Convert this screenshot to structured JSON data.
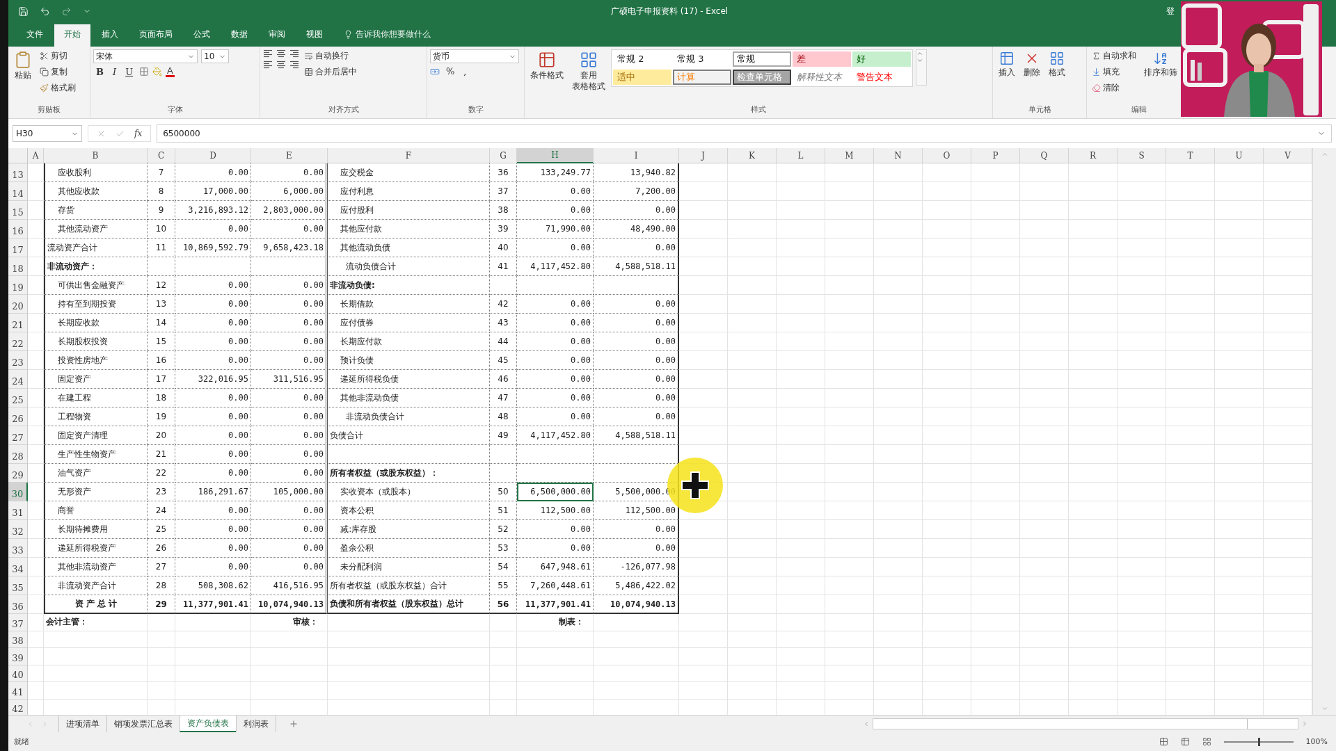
{
  "title_bar": {
    "title": "广硕电子申报资料 (17)  -  Excel",
    "account": "登"
  },
  "menu_tabs": [
    {
      "label": "文件",
      "selected": false
    },
    {
      "label": "开始",
      "selected": true
    },
    {
      "label": "插入",
      "selected": false
    },
    {
      "label": "页面布局",
      "selected": false
    },
    {
      "label": "公式",
      "selected": false
    },
    {
      "label": "数据",
      "selected": false
    },
    {
      "label": "审阅",
      "selected": false
    },
    {
      "label": "视图",
      "selected": false
    }
  ],
  "tell_me": "告诉我你想要做什么",
  "ribbon": {
    "clipboard": {
      "paste": "粘贴",
      "cut": "剪切",
      "copy": "复制",
      "format_painter": "格式刷",
      "label": "剪贴板"
    },
    "font": {
      "name": "宋体",
      "size": "10",
      "bold": "B",
      "italic": "I",
      "underline": "U",
      "font_color": "A",
      "label": "字体"
    },
    "alignment": {
      "wrap": "自动换行",
      "merge": "合并后居中",
      "label": "对齐方式"
    },
    "number": {
      "format": "货币",
      "percent": "%",
      "comma": ",",
      "label": "数字"
    },
    "styles": {
      "conditional": "条件格式",
      "table_format": [
        "套用",
        "表格格式"
      ],
      "label": "样式",
      "gallery": [
        {
          "text": "常规 2",
          "kind": "plain"
        },
        {
          "text": "常规 3",
          "kind": "plain"
        },
        {
          "text": "常规",
          "kind": "framed"
        },
        {
          "text": "差",
          "kind": "bad"
        },
        {
          "text": "好",
          "kind": "good"
        },
        {
          "text": "适中",
          "kind": "neutral"
        },
        {
          "text": "计算",
          "kind": "calc"
        },
        {
          "text": "检查单元格",
          "kind": "check"
        },
        {
          "text": "解释性文本",
          "kind": "explanatory"
        },
        {
          "text": "警告文本",
          "kind": "warning"
        }
      ]
    },
    "cells": {
      "insert": "插入",
      "delete": "删除",
      "format": "格式",
      "label": "单元格"
    },
    "editing": {
      "autosum": "自动求和",
      "fill": "填充",
      "clear": "清除",
      "sort": "排序和筛",
      "label": "编辑"
    }
  },
  "formula_bar": {
    "name_box": "H30",
    "fx": "fx",
    "formula": "6500000"
  },
  "sheet": {
    "columns": [
      {
        "label": "A",
        "selected": false
      },
      {
        "label": "B",
        "selected": false
      },
      {
        "label": "C",
        "selected": false
      },
      {
        "label": "D",
        "selected": false
      },
      {
        "label": "E",
        "selected": false
      },
      {
        "label": "F",
        "selected": false
      },
      {
        "label": "G",
        "selected": false
      },
      {
        "label": "H",
        "selected": true
      },
      {
        "label": "I",
        "selected": false
      },
      {
        "label": "J",
        "selected": false
      },
      {
        "label": "K",
        "selected": false
      },
      {
        "label": "L",
        "selected": false
      },
      {
        "label": "M",
        "selected": false
      },
      {
        "label": "N",
        "selected": false
      },
      {
        "label": "O",
        "selected": false
      },
      {
        "label": "P",
        "selected": false
      },
      {
        "label": "Q",
        "selected": false
      },
      {
        "label": "R",
        "selected": false
      },
      {
        "label": "S",
        "selected": false
      },
      {
        "label": "T",
        "selected": false
      },
      {
        "label": "U",
        "selected": false
      },
      {
        "label": "V",
        "selected": false
      }
    ],
    "row_headers": [
      {
        "label": "13",
        "selected": false
      },
      {
        "label": "14",
        "selected": false
      },
      {
        "label": "15",
        "selected": false
      },
      {
        "label": "16",
        "selected": false
      },
      {
        "label": "17",
        "selected": false
      },
      {
        "label": "18",
        "selected": false
      },
      {
        "label": "19",
        "selected": false
      },
      {
        "label": "20",
        "selected": false
      },
      {
        "label": "21",
        "selected": false
      },
      {
        "label": "22",
        "selected": false
      },
      {
        "label": "23",
        "selected": false
      },
      {
        "label": "24",
        "selected": false
      },
      {
        "label": "25",
        "selected": false
      },
      {
        "label": "26",
        "selected": false
      },
      {
        "label": "27",
        "selected": false
      },
      {
        "label": "28",
        "selected": false
      },
      {
        "label": "29",
        "selected": false
      },
      {
        "label": "30",
        "selected": true
      },
      {
        "label": "31",
        "selected": false
      },
      {
        "label": "32",
        "selected": false
      },
      {
        "label": "33",
        "selected": false
      },
      {
        "label": "34",
        "selected": false
      },
      {
        "label": "35",
        "selected": false
      },
      {
        "label": "36",
        "selected": false
      },
      {
        "label": "37",
        "selected": false
      },
      {
        "label": "38",
        "selected": false
      },
      {
        "label": "39",
        "selected": false
      },
      {
        "label": "40",
        "selected": false
      },
      {
        "label": "41",
        "selected": false
      },
      {
        "label": "42",
        "selected": false
      }
    ],
    "rows": [
      {
        "kind": "item",
        "cells": {
          "B": {
            "text": "    应收股利",
            "bold": false
          },
          "C": {
            "text": "7",
            "bold": false
          },
          "D": {
            "text": "0.00",
            "bold": false
          },
          "E": {
            "text": "0.00",
            "bold": false
          },
          "F": {
            "text": "    应交税金",
            "bold": false
          },
          "G": {
            "text": "36",
            "bold": false
          },
          "H": {
            "text": "133,249.77",
            "bold": false
          },
          "I": {
            "text": "13,940.82",
            "bold": false
          }
        }
      },
      {
        "kind": "item",
        "cells": {
          "B": {
            "text": "    其他应收款",
            "bold": false
          },
          "C": {
            "text": "8",
            "bold": false
          },
          "D": {
            "text": "17,000.00",
            "bold": false
          },
          "E": {
            "text": "6,000.00",
            "bold": false
          },
          "F": {
            "text": "    应付利息",
            "bold": false
          },
          "G": {
            "text": "37",
            "bold": false
          },
          "H": {
            "text": "0.00",
            "bold": false
          },
          "I": {
            "text": "7,200.00",
            "bold": false
          }
        }
      },
      {
        "kind": "item",
        "cells": {
          "B": {
            "text": "    存货",
            "bold": false
          },
          "C": {
            "text": "9",
            "bold": false
          },
          "D": {
            "text": "3,216,893.12",
            "bold": false
          },
          "E": {
            "text": "2,803,000.00",
            "bold": false
          },
          "F": {
            "text": "    应付股利",
            "bold": false
          },
          "G": {
            "text": "38",
            "bold": false
          },
          "H": {
            "text": "0.00",
            "bold": false
          },
          "I": {
            "text": "0.00",
            "bold": false
          }
        }
      },
      {
        "kind": "item",
        "cells": {
          "B": {
            "text": "    其他流动资产",
            "bold": false
          },
          "C": {
            "text": "10",
            "bold": false
          },
          "D": {
            "text": "0.00",
            "bold": false
          },
          "E": {
            "text": "0.00",
            "bold": false
          },
          "F": {
            "text": "    其他应付款",
            "bold": false
          },
          "G": {
            "text": "39",
            "bold": false
          },
          "H": {
            "text": "71,990.00",
            "bold": false
          },
          "I": {
            "text": "48,490.00",
            "bold": false
          }
        }
      },
      {
        "kind": "item",
        "cells": {
          "B": {
            "text": "流动资产合计",
            "bold": false
          },
          "C": {
            "text": "11",
            "bold": false
          },
          "D": {
            "text": "10,869,592.79",
            "bold": false
          },
          "E": {
            "text": "9,658,423.18",
            "bold": false
          },
          "F": {
            "text": "    其他流动负债",
            "bold": false
          },
          "G": {
            "text": "40",
            "bold": false
          },
          "H": {
            "text": "0.00",
            "bold": false
          },
          "I": {
            "text": "0.00",
            "bold": false
          }
        }
      },
      {
        "kind": "item",
        "cells": {
          "B": {
            "text": "非流动资产：",
            "bold": true
          },
          "F": {
            "text": "      流动负债合计",
            "bold": false
          },
          "G": {
            "text": "41",
            "bold": false
          },
          "H": {
            "text": "4,117,452.80",
            "bold": false
          },
          "I": {
            "text": "4,588,518.11",
            "bold": false
          }
        }
      },
      {
        "kind": "item",
        "cells": {
          "B": {
            "text": "    可供出售金融资产",
            "bold": false
          },
          "C": {
            "text": "12",
            "bold": false
          },
          "D": {
            "text": "0.00",
            "bold": false
          },
          "E": {
            "text": "0.00",
            "bold": false
          },
          "F": {
            "text": "非流动负债:",
            "bold": true
          }
        }
      },
      {
        "kind": "item",
        "cells": {
          "B": {
            "text": "    持有至到期投资",
            "bold": false
          },
          "C": {
            "text": "13",
            "bold": false
          },
          "D": {
            "text": "0.00",
            "bold": false
          },
          "E": {
            "text": "0.00",
            "bold": false
          },
          "F": {
            "text": "    长期借款",
            "bold": false
          },
          "G": {
            "text": "42",
            "bold": false
          },
          "H": {
            "text": "0.00",
            "bold": false
          },
          "I": {
            "text": "0.00",
            "bold": false
          }
        }
      },
      {
        "kind": "item",
        "cells": {
          "B": {
            "text": "    长期应收款",
            "bold": false
          },
          "C": {
            "text": "14",
            "bold": false
          },
          "D": {
            "text": "0.00",
            "bold": false
          },
          "E": {
            "text": "0.00",
            "bold": false
          },
          "F": {
            "text": "    应付债券",
            "bold": false
          },
          "G": {
            "text": "43",
            "bold": false
          },
          "H": {
            "text": "0.00",
            "bold": false
          },
          "I": {
            "text": "0.00",
            "bold": false
          }
        }
      },
      {
        "kind": "item",
        "cells": {
          "B": {
            "text": "    长期股权投资",
            "bold": false
          },
          "C": {
            "text": "15",
            "bold": false
          },
          "D": {
            "text": "0.00",
            "bold": false
          },
          "E": {
            "text": "0.00",
            "bold": false
          },
          "F": {
            "text": "    长期应付款",
            "bold": false
          },
          "G": {
            "text": "44",
            "bold": false
          },
          "H": {
            "text": "0.00",
            "bold": false
          },
          "I": {
            "text": "0.00",
            "bold": false
          }
        }
      },
      {
        "kind": "item",
        "cells": {
          "B": {
            "text": "    投资性房地产",
            "bold": false
          },
          "C": {
            "text": "16",
            "bold": false
          },
          "D": {
            "text": "0.00",
            "bold": false
          },
          "E": {
            "text": "0.00",
            "bold": false
          },
          "F": {
            "text": "    预计负债",
            "bold": false
          },
          "G": {
            "text": "45",
            "bold": false
          },
          "H": {
            "text": "0.00",
            "bold": false
          },
          "I": {
            "text": "0.00",
            "bold": false
          }
        }
      },
      {
        "kind": "item",
        "cells": {
          "B": {
            "text": "    固定资产",
            "bold": false
          },
          "C": {
            "text": "17",
            "bold": false
          },
          "D": {
            "text": "322,016.95",
            "bold": false
          },
          "E": {
            "text": "311,516.95",
            "bold": false
          },
          "F": {
            "text": "    递延所得税负债",
            "bold": false
          },
          "G": {
            "text": "46",
            "bold": false
          },
          "H": {
            "text": "0.00",
            "bold": false
          },
          "I": {
            "text": "0.00",
            "bold": false
          }
        }
      },
      {
        "kind": "item",
        "cells": {
          "B": {
            "text": "    在建工程",
            "bold": false
          },
          "C": {
            "text": "18",
            "bold": false
          },
          "D": {
            "text": "0.00",
            "bold": false
          },
          "E": {
            "text": "0.00",
            "bold": false
          },
          "F": {
            "text": "    其他非流动负债",
            "bold": false
          },
          "G": {
            "text": "47",
            "bold": false
          },
          "H": {
            "text": "0.00",
            "bold": false
          },
          "I": {
            "text": "0.00",
            "bold": false
          }
        }
      },
      {
        "kind": "item",
        "cells": {
          "B": {
            "text": "    工程物资",
            "bold": false
          },
          "C": {
            "text": "19",
            "bold": false
          },
          "D": {
            "text": "0.00",
            "bold": false
          },
          "E": {
            "text": "0.00",
            "bold": false
          },
          "F": {
            "text": "      非流动负债合计",
            "bold": false
          },
          "G": {
            "text": "48",
            "bold": false
          },
          "H": {
            "text": "0.00",
            "bold": false
          },
          "I": {
            "text": "0.00",
            "bold": false
          }
        }
      },
      {
        "kind": "item",
        "cells": {
          "B": {
            "text": "    固定资产清理",
            "bold": false
          },
          "C": {
            "text": "20",
            "bold": false
          },
          "D": {
            "text": "0.00",
            "bold": false
          },
          "E": {
            "text": "0.00",
            "bold": false
          },
          "F": {
            "text": "负债合计",
            "bold": false
          },
          "G": {
            "text": "49",
            "bold": false
          },
          "H": {
            "text": "4,117,452.80",
            "bold": false
          },
          "I": {
            "text": "4,588,518.11",
            "bold": false
          }
        }
      },
      {
        "kind": "item",
        "cells": {
          "B": {
            "text": "    生产性生物资产",
            "bold": false
          },
          "C": {
            "text": "21",
            "bold": false
          },
          "D": {
            "text": "0.00",
            "bold": false
          },
          "E": {
            "text": "0.00",
            "bold": false
          }
        }
      },
      {
        "kind": "item",
        "cells": {
          "B": {
            "text": "    油气资产",
            "bold": false
          },
          "C": {
            "text": "22",
            "bold": false
          },
          "D": {
            "text": "0.00",
            "bold": false
          },
          "E": {
            "text": "0.00",
            "bold": false
          },
          "F": {
            "text": "所有者权益（或股东权益）：",
            "bold": true
          }
        }
      },
      {
        "kind": "item",
        "cells": {
          "B": {
            "text": "    无形资产",
            "bold": false
          },
          "C": {
            "text": "23",
            "bold": false
          },
          "D": {
            "text": "186,291.67",
            "bold": false
          },
          "E": {
            "text": "105,000.00",
            "bold": false
          },
          "F": {
            "text": "    实收资本（或股本）",
            "bold": false
          },
          "G": {
            "text": "50",
            "bold": false
          },
          "H": {
            "text": "6,500,000.00",
            "bold": false
          },
          "I": {
            "text": "5,500,000.00",
            "bold": false
          }
        }
      },
      {
        "kind": "item",
        "cells": {
          "B": {
            "text": "    商誉",
            "bold": false
          },
          "C": {
            "text": "24",
            "bold": false
          },
          "D": {
            "text": "0.00",
            "bold": false
          },
          "E": {
            "text": "0.00",
            "bold": false
          },
          "F": {
            "text": "    资本公积",
            "bold": false
          },
          "G": {
            "text": "51",
            "bold": false
          },
          "H": {
            "text": "112,500.00",
            "bold": false
          },
          "I": {
            "text": "112,500.00",
            "bold": false
          }
        }
      },
      {
        "kind": "item",
        "cells": {
          "B": {
            "text": "    长期待摊费用",
            "bold": false
          },
          "C": {
            "text": "25",
            "bold": false
          },
          "D": {
            "text": "0.00",
            "bold": false
          },
          "E": {
            "text": "0.00",
            "bold": false
          },
          "F": {
            "text": "    减:库存股",
            "bold": false
          },
          "G": {
            "text": "52",
            "bold": false
          },
          "H": {
            "text": "0.00",
            "bold": false
          },
          "I": {
            "text": "0.00",
            "bold": false
          }
        }
      },
      {
        "kind": "item",
        "cells": {
          "B": {
            "text": "    递延所得税资产",
            "bold": false
          },
          "C": {
            "text": "26",
            "bold": false
          },
          "D": {
            "text": "0.00",
            "bold": false
          },
          "E": {
            "text": "0.00",
            "bold": false
          },
          "F": {
            "text": "    盈余公积",
            "bold": false
          },
          "G": {
            "text": "53",
            "bold": false
          },
          "H": {
            "text": "0.00",
            "bold": false
          },
          "I": {
            "text": "0.00",
            "bold": false
          }
        }
      },
      {
        "kind": "item",
        "cells": {
          "B": {
            "text": "    其他非流动资产",
            "bold": false
          },
          "C": {
            "text": "27",
            "bold": false
          },
          "D": {
            "text": "0.00",
            "bold": false
          },
          "E": {
            "text": "0.00",
            "bold": false
          },
          "F": {
            "text": "    未分配利润",
            "bold": false
          },
          "G": {
            "text": "54",
            "bold": false
          },
          "H": {
            "text": "647,948.61",
            "bold": false
          },
          "I": {
            "text": "-126,077.98",
            "bold": false
          }
        }
      },
      {
        "kind": "item",
        "cells": {
          "B": {
            "text": "    非流动资产合计",
            "bold": false
          },
          "C": {
            "text": "28",
            "bold": false
          },
          "D": {
            "text": "508,308.62",
            "bold": false
          },
          "E": {
            "text": "416,516.95",
            "bold": false
          },
          "F": {
            "text": "所有者权益（或股东权益）合计",
            "bold": false
          },
          "G": {
            "text": "55",
            "bold": false
          },
          "H": {
            "text": "7,260,448.61",
            "bold": false
          },
          "I": {
            "text": "5,486,422.02",
            "bold": false
          }
        }
      },
      {
        "kind": "total",
        "cells": {
          "B": {
            "text": "资 产 总 计",
            "bold": true
          },
          "C": {
            "text": "29",
            "bold": true
          },
          "D": {
            "text": "11,377,901.41",
            "bold": true
          },
          "E": {
            "text": "10,074,940.13",
            "bold": true
          },
          "F": {
            "text": "负债和所有者权益（股东权益）总计",
            "bold": true
          },
          "G": {
            "text": "56",
            "bold": true
          },
          "H": {
            "text": "11,377,901.41",
            "bold": true
          },
          "I": {
            "text": "10,074,940.13",
            "bold": true
          }
        }
      },
      {
        "kind": "signature",
        "cells": {
          "B": {
            "text": "会计主管：",
            "bold": true
          },
          "E": {
            "text": "审核：",
            "bold": true
          },
          "H": {
            "text": "制表：",
            "bold": true
          }
        }
      },
      {
        "kind": "blank"
      },
      {
        "kind": "blank"
      },
      {
        "kind": "blank"
      },
      {
        "kind": "blank"
      },
      {
        "kind": "blank"
      }
    ]
  },
  "sheet_tabs": [
    {
      "label": "进项清单",
      "selected": false
    },
    {
      "label": "销项发票汇总表",
      "selected": false
    },
    {
      "label": "资产负债表",
      "selected": true
    },
    {
      "label": "利润表",
      "selected": false
    }
  ],
  "status_bar": {
    "status": "就绪",
    "zoom_slider": {
      "level": 0.5
    },
    "zoom": "100%"
  }
}
